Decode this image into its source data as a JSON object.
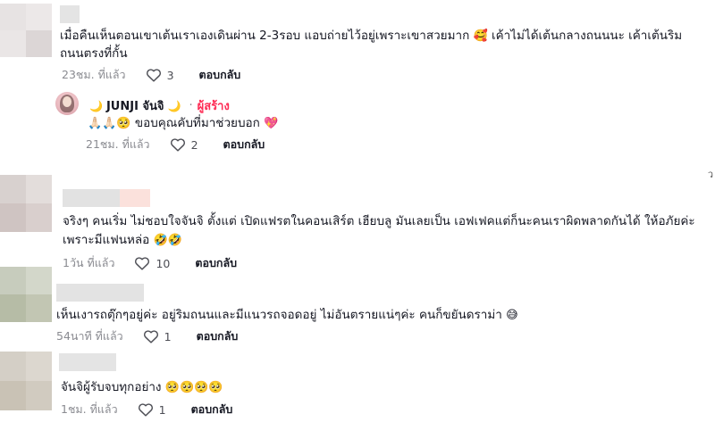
{
  "comments": [
    {
      "text_line1": "เมื่อคืนเห็นตอนเขาเต้นเราเองเดินผ่าน 2-3รอบ แอบถ่ายไว้อยู่เพราะเขาสวยมาก",
      "text_emoji1": "🥰",
      "text_line1b": " เค้าไม่ได้เต้นกลางถนนนะ เค้าเต้นริม",
      "text_line2": "ถนนตรงที่กั้น",
      "time": "23ชม. ที่แล้ว",
      "likes": "3",
      "reply_label": "ตอบกลับ"
    },
    {
      "creator_moon_left": "🌙",
      "creator_name": "JUNJI จันจิ",
      "creator_moon_right": "🌙",
      "dot": "·",
      "creator_badge": "ผู้สร้าง",
      "text_emojis": "🙏🏻🙏🏻🥺",
      "text": " ขอบคุณคับที่มาช่วยบอก",
      "text_heart": "💖",
      "time": "21ชม. ที่แล้ว",
      "likes": "2",
      "reply_label": "ตอบกลับ"
    },
    {
      "text_line1": "จริงๆ คนเริ่ม ไม่ชอบใจจันจิ ตั้งแต่ เปิดแฟรตในคอนเสิร์ต เฮียบลู มันเลยเป็น เอฟเฟคแต่ก็นะคนเราผิดพลาดกันได้ ให้อภัยค่ะ",
      "text_line2": "เพราะมีแฟนหล่อ",
      "text_emoji2": "🤣🤣",
      "time": "1วัน ที่แล้ว",
      "likes": "10",
      "reply_label": "ตอบกลับ"
    },
    {
      "text": "เห็นเงารถตุ๊กๆอยู่ค่ะ อยู่ริมถนนและมีแนวรถจอดอยู่ ไม่อันตรายแน่ๆค่ะ คนก็ขยันดราม่า",
      "text_emoji": "😅",
      "time": "54นาที ที่แล้ว",
      "likes": "1",
      "reply_label": "ตอบกลับ"
    },
    {
      "text": "จันจิผู้รับจบทุกอย่าง",
      "text_emoji": "🥺🥺🥺🥺",
      "time": "1ชม. ที่แล้ว",
      "likes": "1",
      "reply_label": "ตอบกลับ"
    }
  ],
  "edge_mark": "ว",
  "colors": {
    "text": "#161823",
    "meta": "#8a8b91",
    "creator_badge": "#fe2c55"
  }
}
